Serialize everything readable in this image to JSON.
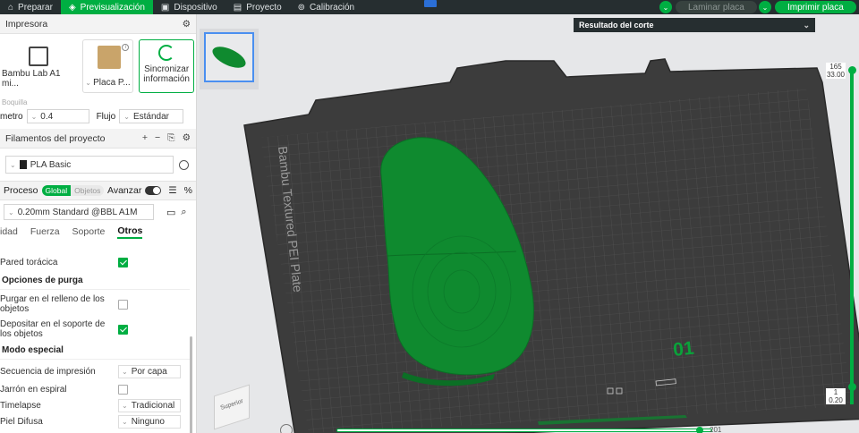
{
  "topbar": {
    "tabs": [
      {
        "label": "Preparar",
        "icon": "home-icon",
        "active": false
      },
      {
        "label": "Previsualización",
        "icon": "layers-icon",
        "active": true
      },
      {
        "label": "Dispositivo",
        "icon": "device-icon",
        "active": false
      },
      {
        "label": "Proyecto",
        "icon": "document-icon",
        "active": false
      },
      {
        "label": "Calibración",
        "icon": "calibration-icon",
        "active": false
      }
    ],
    "slice_label": "Laminar placa",
    "print_label": "Imprimir placa"
  },
  "printer": {
    "title": "Impresora",
    "printer_name": "Bambu Lab A1 mi...",
    "plate_name": "Placa P...",
    "sync_label_1": "Sincronizar",
    "sync_label_2": "información",
    "nozzle_caption": "Boquilla",
    "nozzle_label": "metro",
    "nozzle_value": "0.4",
    "flow_label": "Flujo",
    "flow_value": "Estándar"
  },
  "filaments": {
    "title": "Filamentos del proyecto",
    "item": "PLA Basic"
  },
  "process": {
    "title": "Proceso",
    "global": "Global",
    "objects": "Objetos",
    "advanced": "Avanzar",
    "preset": "0.20mm Standard @BBL A1M",
    "tabs": [
      "idad",
      "Fuerza",
      "Soporte",
      "Otros"
    ],
    "params": {
      "pared_toracica": "Pared torácica",
      "purge_group": "Opciones de purga",
      "purge_fill_1": "Purgar en el relleno de los",
      "purge_fill_2": "objetos",
      "purge_support_1": "Depositar en el soporte de",
      "purge_support_2": "los objetos",
      "special_group": "Modo especial",
      "print_seq": "Secuencia de impresión",
      "print_seq_val": "Por capa",
      "spiral": "Jarrón en espiral",
      "timelapse": "Timelapse",
      "timelapse_val": "Tradicional",
      "fuzzy": "Piel Difusa",
      "fuzzy_val": "Ninguno"
    }
  },
  "viewport": {
    "result_title": "Resultado del corte",
    "plate_text": "Bambu Textured PEI Plate",
    "plate_number": "01",
    "cube_label": "Superior",
    "layer_top": "165",
    "layer_top_z": "33.00",
    "layer_bottom": "1",
    "layer_bottom_z": "0.20",
    "bottom_value": "201"
  },
  "colors": {
    "accent": "#00ae42",
    "topbar": "#262e30",
    "plate": "#3d3d3d",
    "model": "#0f8a2f"
  }
}
